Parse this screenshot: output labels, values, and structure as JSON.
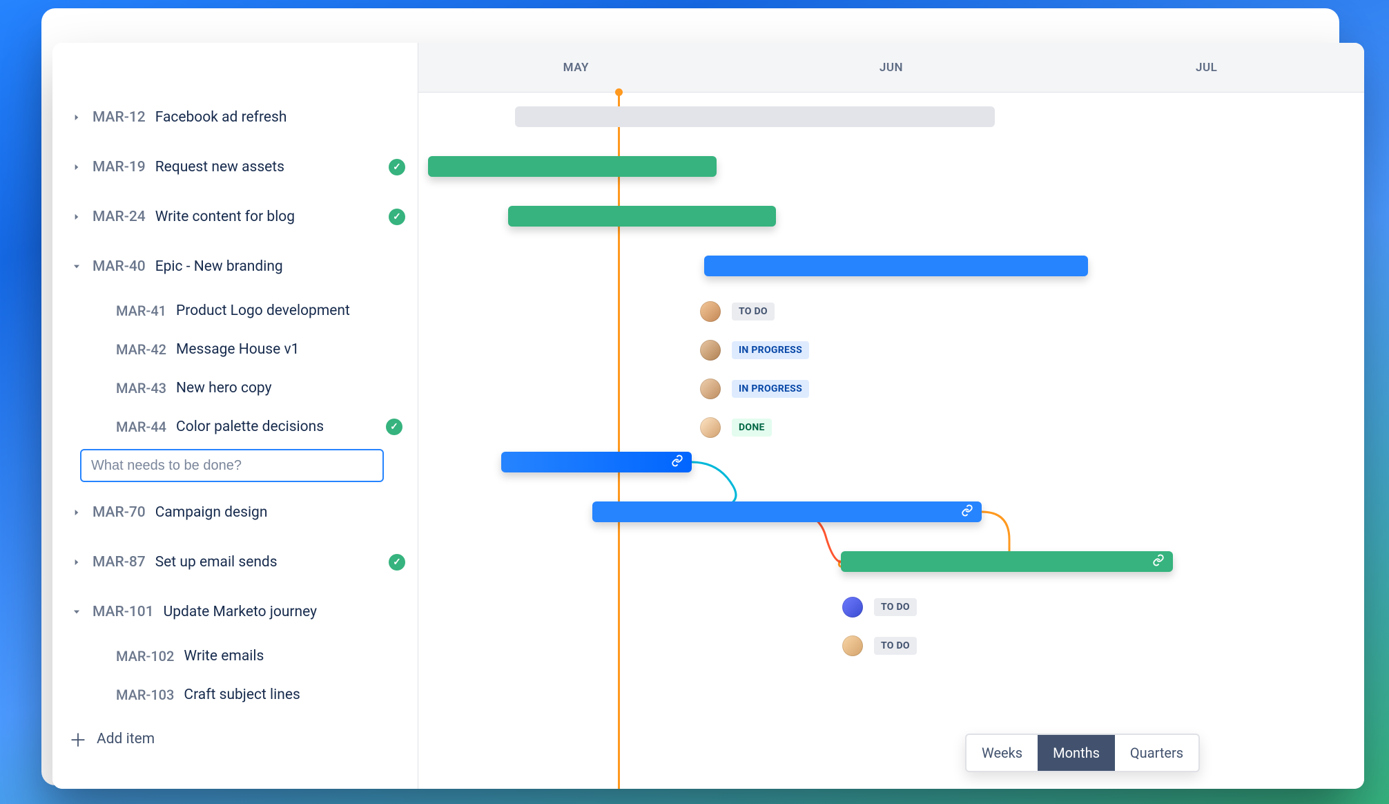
{
  "header": {
    "months": [
      "MAY",
      "JUN",
      "JUL"
    ]
  },
  "sidebar": {
    "items": [
      {
        "id": "MAR-12",
        "title": "Facebook ad refresh",
        "expand": "closed",
        "done": false
      },
      {
        "id": "MAR-19",
        "title": "Request new assets",
        "expand": "closed",
        "done": true
      },
      {
        "id": "MAR-24",
        "title": "Write content for blog",
        "expand": "closed",
        "done": true
      },
      {
        "id": "MAR-40",
        "title": "Epic - New branding",
        "expand": "open",
        "done": false
      },
      {
        "id": "MAR-41",
        "title": "Product Logo development",
        "child": true,
        "done": false
      },
      {
        "id": "MAR-42",
        "title": "Message House v1",
        "child": true,
        "done": false
      },
      {
        "id": "MAR-43",
        "title": "New hero copy",
        "child": true,
        "done": false
      },
      {
        "id": "MAR-44",
        "title": "Color palette decisions",
        "child": true,
        "done": true
      },
      {
        "id": "MAR-70",
        "title": "Campaign design",
        "expand": "closed",
        "done": false
      },
      {
        "id": "MAR-87",
        "title": "Set up email sends",
        "expand": "closed",
        "done": true
      },
      {
        "id": "MAR-101",
        "title": "Update Marketo journey",
        "expand": "open",
        "done": false
      },
      {
        "id": "MAR-102",
        "title": "Write emails",
        "child": true,
        "done": false
      },
      {
        "id": "MAR-103",
        "title": "Craft subject lines",
        "child": true,
        "done": false
      }
    ],
    "new_task_placeholder": "What needs to be done?",
    "add_item_label": "Add item"
  },
  "timeline": {
    "statuses": {
      "todo": "TO DO",
      "in_progress": "IN PROGRESS",
      "done": "DONE"
    },
    "sub_rows": [
      {
        "status": "todo"
      },
      {
        "status": "in_progress"
      },
      {
        "status": "in_progress"
      },
      {
        "status": "done"
      },
      {
        "status": "todo"
      },
      {
        "status": "todo"
      }
    ],
    "zoom": {
      "options": [
        "Weeks",
        "Months",
        "Quarters"
      ],
      "active": 1
    }
  },
  "colors": {
    "green": "#36B37E",
    "blue": "#2684FF",
    "orange": "#FF991F",
    "grey": "#E2E4E9"
  }
}
